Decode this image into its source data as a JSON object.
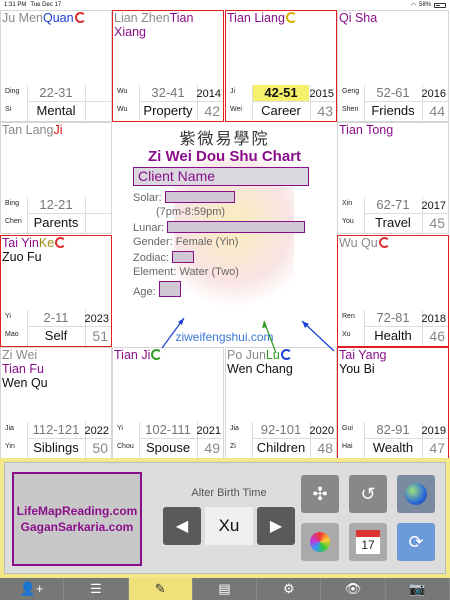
{
  "status": {
    "time": "1:31 PM",
    "date": "Tue Dec 17",
    "battery": "58%"
  },
  "palaces": [
    {
      "stars": [
        {
          "t": "Ju Men",
          "c": "gray"
        },
        {
          "t": "Quan",
          "c": "blue",
          "cycle": "red"
        }
      ],
      "range": "22-31",
      "name": "Mental",
      "stem": "Ding",
      "branch": "Si",
      "year": "",
      "age": "",
      "highlight": false,
      "red": false
    },
    {
      "stars": [
        {
          "t": "Lian Zhen",
          "c": "gray"
        },
        {
          "t": "Tian Xiang",
          "c": "purple"
        }
      ],
      "range": "32-41",
      "name": "Property",
      "stem": "Wu",
      "branch": "Wu",
      "year": "2014",
      "age": "42",
      "highlight": false,
      "red": true
    },
    {
      "stars": [
        {
          "t": "Tian Liang",
          "c": "purple",
          "cycle": "yellow"
        }
      ],
      "range": "42-51",
      "name": "Career",
      "stem": "Ji",
      "branch": "Wei",
      "year": "2015",
      "age": "43",
      "highlight": true,
      "red": true
    },
    {
      "stars": [
        {
          "t": "Qi Sha",
          "c": "purple"
        }
      ],
      "range": "52-61",
      "name": "Friends",
      "stem": "Geng",
      "branch": "Shen",
      "year": "2016",
      "age": "44",
      "highlight": false,
      "red": false
    },
    {
      "stars": [
        {
          "t": "Tan Lang",
          "c": "gray"
        },
        {
          "t": "Ji",
          "c": "red"
        }
      ],
      "range": "12-21",
      "name": "Parents",
      "stem": "Bing",
      "branch": "Chen",
      "year": "",
      "age": "",
      "highlight": false,
      "red": false
    },
    {
      "stars": [
        {
          "t": "Tian Tong",
          "c": "purple"
        }
      ],
      "range": "62-71",
      "name": "Travel",
      "stem": "Xin",
      "branch": "You",
      "year": "2017",
      "age": "45",
      "highlight": false,
      "red": false
    },
    {
      "stars": [
        {
          "t": "Tai Yin",
          "c": "purple"
        },
        {
          "t": "Ke",
          "c": "olive",
          "cycle": "red"
        },
        {
          "t": "Zuo Fu",
          "c": "black",
          "block": true
        }
      ],
      "range": "2-11",
      "name": "Self",
      "stem": "Yi",
      "branch": "Mao",
      "year": "2023",
      "age": "51",
      "highlight": false,
      "red": true
    },
    {
      "stars": [
        {
          "t": "Wu Qu",
          "c": "gray",
          "cycle": "red"
        }
      ],
      "range": "72-81",
      "name": "Health",
      "stem": "Ren",
      "branch": "Xu",
      "year": "2018",
      "age": "46",
      "highlight": false,
      "red": true
    },
    {
      "stars": [
        {
          "t": "Zi Wei",
          "c": "gray"
        },
        {
          "t": "Tian Fu",
          "c": "purple",
          "block": true
        },
        {
          "t": "Wen Qu",
          "c": "black",
          "block": true
        }
      ],
      "range": "112-121",
      "name": "Siblings",
      "stem": "Jia",
      "branch": "Yin",
      "year": "2022",
      "age": "50",
      "highlight": false,
      "red": false
    },
    {
      "stars": [
        {
          "t": "Tian Ji",
          "c": "purple",
          "cycle": "green"
        }
      ],
      "range": "102-111",
      "name": "Spouse",
      "stem": "Yi",
      "branch": "Chou",
      "year": "2021",
      "age": "49",
      "highlight": false,
      "red": false
    },
    {
      "stars": [
        {
          "t": "Po Jun",
          "c": "gray"
        },
        {
          "t": "Lu",
          "c": "green",
          "cycle": "blue"
        },
        {
          "t": "Wen Chang",
          "c": "black",
          "block": true
        }
      ],
      "range": "92-101",
      "name": "Children",
      "stem": "Jia",
      "branch": "Zi",
      "year": "2020",
      "age": "48",
      "highlight": false,
      "red": false
    },
    {
      "stars": [
        {
          "t": "Tai Yang",
          "c": "purple"
        },
        {
          "t": "You Bi",
          "c": "black",
          "block": true
        }
      ],
      "range": "82-91",
      "name": "Wealth",
      "stem": "Gui",
      "branch": "Hai",
      "year": "2019",
      "age": "47",
      "highlight": false,
      "red": true
    }
  ],
  "center": {
    "cn_title": "紫微易學院",
    "title": "Zi Wei Dou Shu Chart",
    "client_name": "Client Name",
    "solar_label": "Solar:",
    "time_range": "(7pm-8:59pm)",
    "lunar_label": "Lunar:",
    "gender": "Gender: Female (Yin)",
    "zodiac_label": "Zodiac:",
    "element": "Element: Water (Two)",
    "age_label": "Age:",
    "website": "ziweifengshui.com",
    "arrow_colors": [
      "#1b3fd6",
      "#2e9a24",
      "#1b3fd6"
    ]
  },
  "panel": {
    "logo_line1": "LifeMapReading.com",
    "logo_line2": "GaganSarkaria.com",
    "alter_title": "Alter Birth Time",
    "prev_label": "◀",
    "next_label": "▶",
    "current_hour": "Xu",
    "calendar_day": "17"
  },
  "tabs": [
    "👤+",
    "☰",
    "✎",
    "▤",
    "⚙",
    "👁",
    "📷"
  ],
  "accent": "#8a0e8a"
}
